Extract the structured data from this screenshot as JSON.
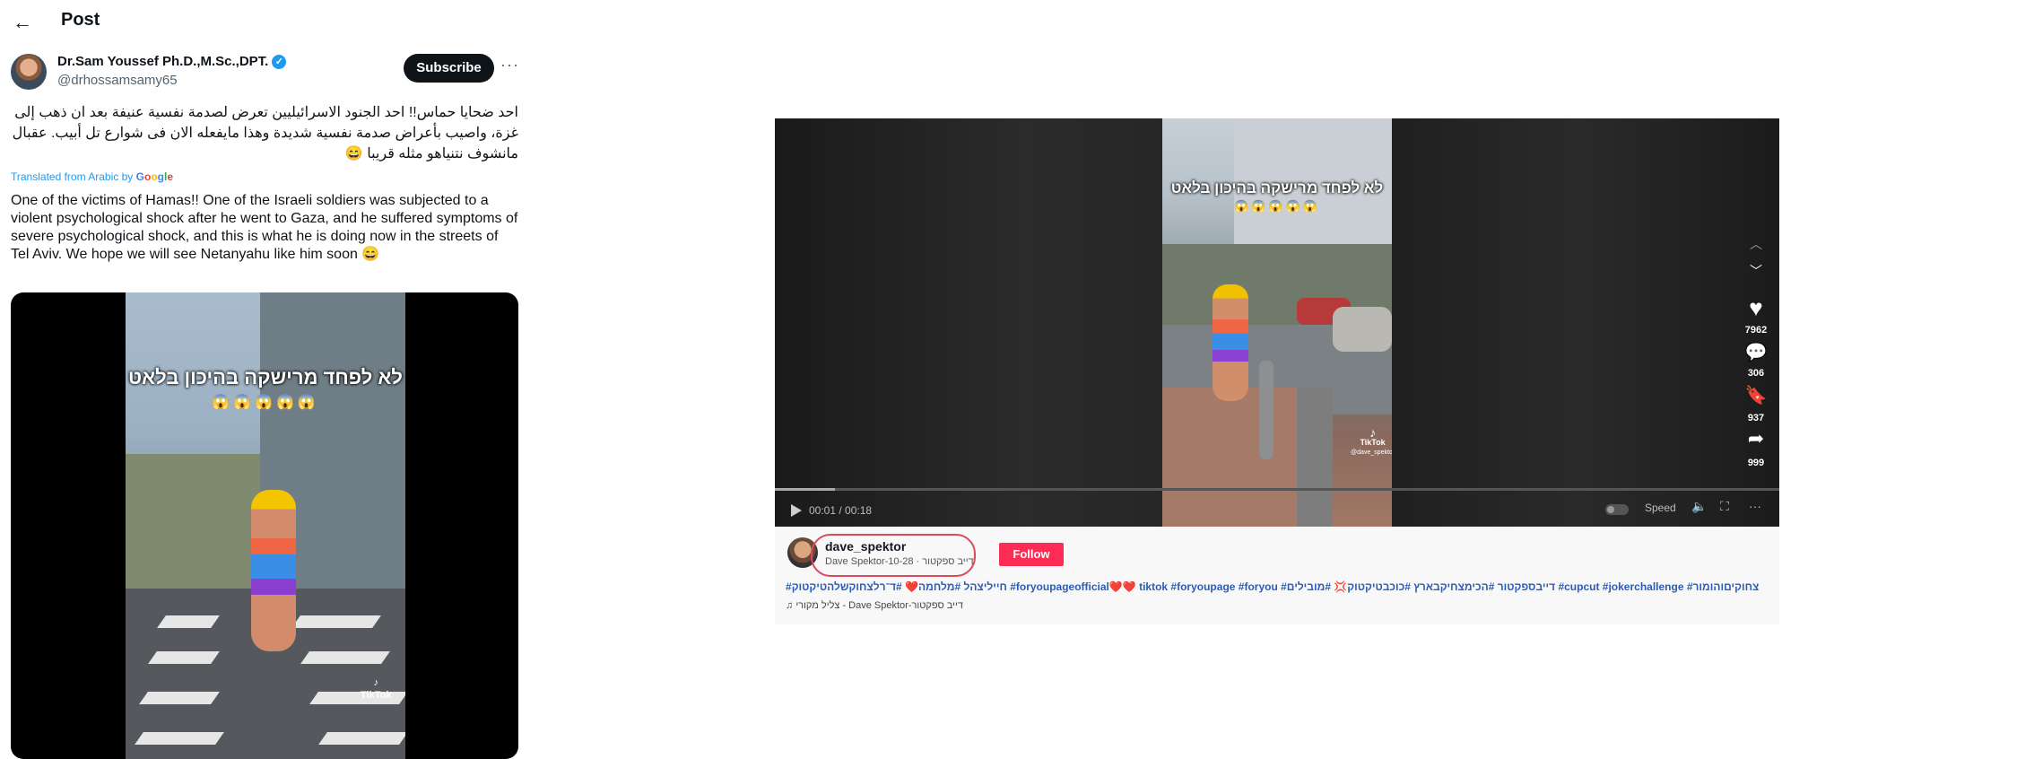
{
  "header": {
    "back_icon": "arrow-left-icon",
    "title": "Post"
  },
  "author": {
    "name": "Dr.Sam Youssef Ph.D.,M.Sc.,DPT.",
    "handle": "@drhossamsamy65",
    "verified_badge": "✓",
    "subscribe_label": "Subscribe",
    "more_label": "···"
  },
  "post": {
    "arabic_text": "احد ضحايا حماس!! احد الجنود الاسرائيليين تعرض لصدمة نفسية عنيفة بعد ان ذهب إلى غزة، واصيب بأعراض صدمة نفسية شديدة وهذا مايفعله الان فى شوارع تل أبيب. عقبال مانشوف نتنياهو مثله قريبا 😄",
    "translated_prefix": "Translated from Arabic by",
    "google_logo": [
      "G",
      "o",
      "o",
      "g",
      "l",
      "e"
    ],
    "english_text": "One of the victims of Hamas!! One of the Israeli soldiers was subjected to a violent psychological shock after he went to Gaza, and he suffered symptoms of severe psychological shock, and this is what he is doing now in the streets of Tel Aviv. We hope we will see Netanyahu like him soon 😄"
  },
  "video_overlay": {
    "hebrew": "לא לפחד מרישקה בהיכון בלאט",
    "emojis": "😱😱😱😱😱",
    "tiktok_mark": "TikTok",
    "tiktok_watermark": "@dave_spektor"
  },
  "tiktok_player": {
    "time": "00:01 / 00:18",
    "progress_fraction": 0.06,
    "speed_label": "Speed",
    "volume_icon": "speaker-icon",
    "fullscreen_icon": "fullscreen-icon",
    "more_icon": "more-horizontal-icon",
    "like_count": "7962",
    "comment_count": "306",
    "save_count": "937",
    "share_count": "999",
    "up_icon": "chevron-up-icon",
    "down_icon": "chevron-down-icon"
  },
  "tiktok_info": {
    "username": "dave_spektor",
    "subline": "Dave Spektor-דייב ספקטור · 10-28",
    "follow_label": "Follow",
    "hashtags": "#חייליצהל #מלחמה❤️ #ד־רלצחוקשלהטיקטוק #foryoupageofficial❤️❤️ tiktok #foryoupage #foryou #דייבספקטור #הכימצחיקבארץ #כוכבטיקטוק💢 #מובילים #cupcut #jokerchallenge #צחוקיםוהומור",
    "music": "♫ צליל מקורי - Dave Spektor-דייב ספקטור"
  }
}
